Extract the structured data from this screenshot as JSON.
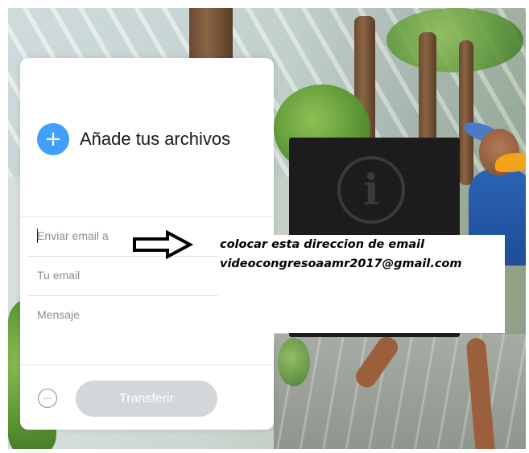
{
  "upload_card": {
    "add_files_label": "Añade tus archivos",
    "add_icon_glyph": "+",
    "email_to_placeholder": "Enviar email a",
    "your_email_placeholder": "Tu email",
    "message_placeholder": "Mensaje",
    "more_options_glyph": "···",
    "transfer_label": "Transferir"
  },
  "overlay": {
    "info_icon": "info-icon",
    "info_glyph": "i"
  },
  "annotation": {
    "line1": "colocar esta direccion de email",
    "line2": "videocongresoaamr2017@gmail.com"
  },
  "colors": {
    "accent": "#409fff",
    "transfer_button_disabled": "#d4d7d9",
    "overlay_dark": "#1c1c1c"
  }
}
